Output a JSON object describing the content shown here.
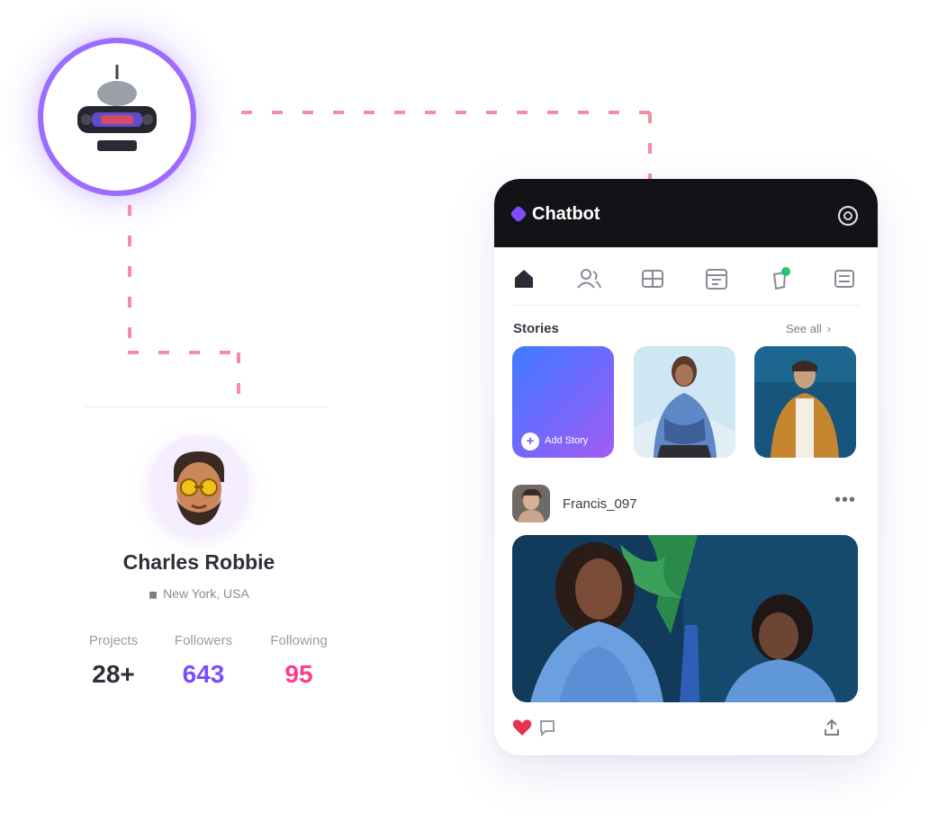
{
  "logo": {
    "icon": "org-emblem-icon",
    "ring_color": "#9b6cff"
  },
  "profile": {
    "name": "Charles Robbie",
    "location": "New York, USA",
    "stats": [
      {
        "label": "Projects",
        "value": "28+",
        "color": "#2f2f3a"
      },
      {
        "label": "Followers",
        "value": "643",
        "color": "#7a4dff"
      },
      {
        "label": "Following",
        "value": "95",
        "color": "#ff3d8a"
      }
    ]
  },
  "app": {
    "brand": "Chatbot",
    "header_icon": "settings-icon",
    "tabs": [
      "home-icon",
      "users-icon",
      "grid-icon",
      "calendar-icon",
      "notification-icon",
      "menu-icon"
    ],
    "stories": {
      "title": "Stories",
      "see_all": "See all",
      "add_label": "Add Story"
    },
    "post": {
      "username": "Francis_097",
      "more": "•••",
      "actions": [
        "heart-icon",
        "comment-icon",
        "share-icon"
      ]
    }
  },
  "colors": {
    "accent": "#7b4dff",
    "connector": "#f58ca3",
    "header_bg": "#121217"
  }
}
